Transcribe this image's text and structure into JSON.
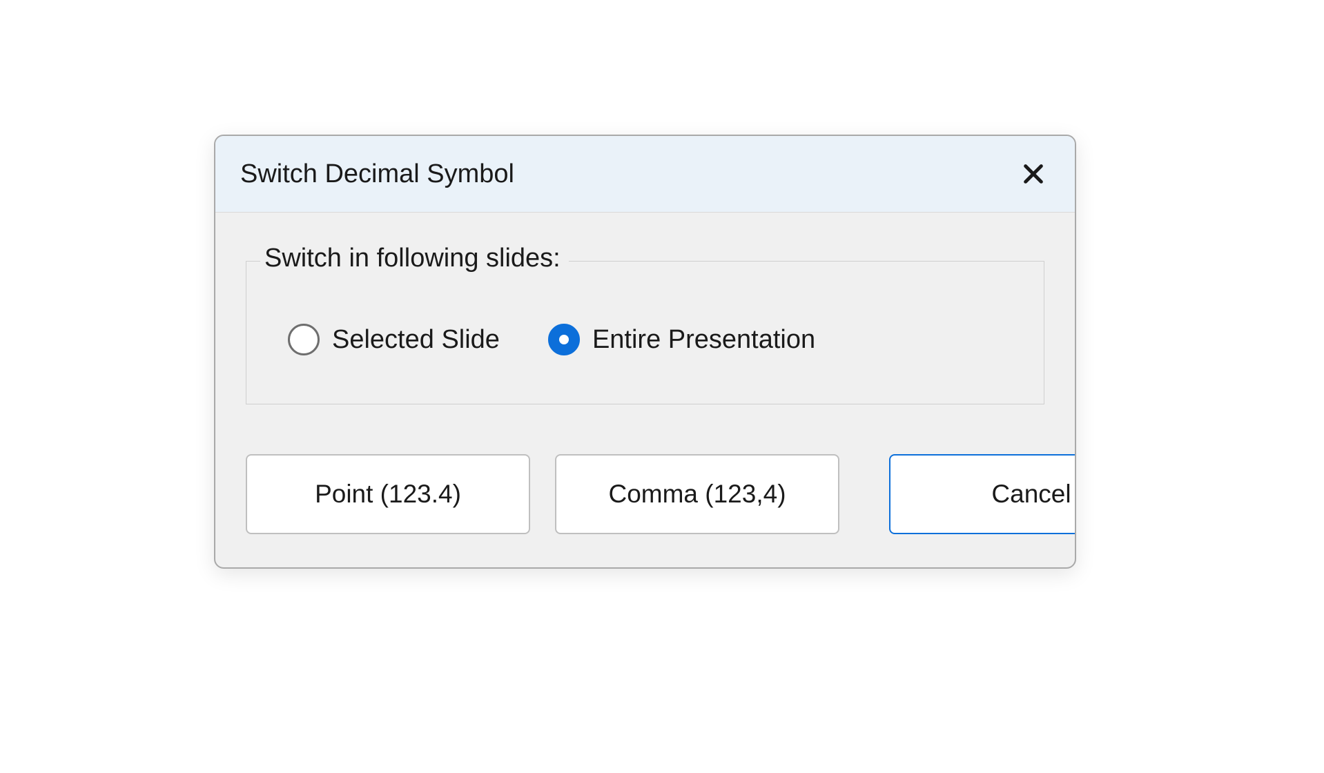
{
  "dialog": {
    "title": "Switch Decimal Symbol",
    "group_legend": "Switch in following slides:",
    "options": [
      {
        "label": "Selected Slide",
        "checked": false
      },
      {
        "label": "Entire Presentation",
        "checked": true
      }
    ],
    "buttons": {
      "point": "Point (123.4)",
      "comma": "Comma (123,4)",
      "cancel": "Cancel"
    },
    "close_icon": "close"
  }
}
